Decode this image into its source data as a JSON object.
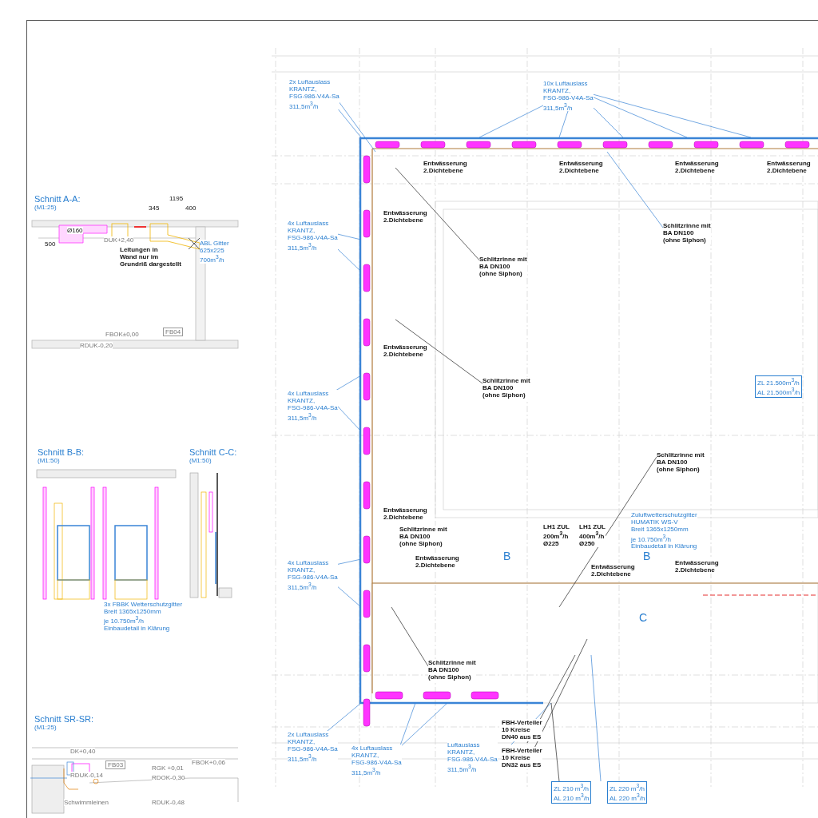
{
  "sections": [
    {
      "title": "Schnitt A-A:",
      "scale": "(M1:25)",
      "labels": [
        {
          "kind": "dimension",
          "lines": [
            "1195"
          ]
        },
        {
          "kind": "dimension",
          "lines": [
            "345"
          ]
        },
        {
          "kind": "dimension",
          "lines": [
            "400"
          ]
        },
        {
          "kind": "dimension",
          "lines": [
            "500"
          ]
        },
        {
          "kind": "dimension",
          "lines": [
            "Ø160"
          ]
        },
        {
          "kind": "level",
          "lines": [
            "DUK+2,40"
          ]
        },
        {
          "kind": "level",
          "lines": [
            "FBOK±0,00"
          ]
        },
        {
          "kind": "room",
          "lines": [
            "FB04"
          ]
        },
        {
          "kind": "level",
          "lines": [
            "RDUK-0,20"
          ]
        },
        {
          "kind": "note",
          "lines": [
            "Leitungen in",
            "Wand nur im",
            "Grundriß dargestellt"
          ]
        },
        {
          "kind": "duct",
          "lines": [
            "ABL Gitter",
            "625x225",
            "700m$^{3}$/h"
          ]
        }
      ]
    },
    {
      "title": "Schnitt B-B:",
      "scale": "(M1:50)",
      "labels": [
        {
          "kind": "duct",
          "lines": [
            "3x FBBK Wetterschutzgitter",
            "Breit 1365x1250mm",
            "je 10.750m$^{3}$/h",
            "Einbaudetail in Klärung"
          ]
        }
      ]
    },
    {
      "title": "Schnitt C-C:",
      "scale": "(M1:50)"
    },
    {
      "title": "Schnitt SR-SR:",
      "scale": "(M1:25)",
      "labels": [
        {
          "kind": "level",
          "lines": [
            "DK+0,40"
          ]
        },
        {
          "kind": "room",
          "lines": [
            "FB03"
          ]
        },
        {
          "kind": "level",
          "lines": [
            "RDUK-0,14"
          ]
        },
        {
          "kind": "level",
          "lines": [
            "RGK +0,01"
          ]
        },
        {
          "kind": "level",
          "lines": [
            "RDOK-0,30"
          ]
        },
        {
          "kind": "level",
          "lines": [
            "FBOK+0,06"
          ]
        },
        {
          "kind": "level",
          "lines": [
            "Schwimmleinen"
          ]
        },
        {
          "kind": "level",
          "lines": [
            "RDUK-0,48"
          ]
        }
      ]
    }
  ],
  "plan_notes": [
    {
      "kind": "duct",
      "lines": [
        "2x Luftauslass",
        "KRANTZ,",
        "FSG-986-V4A-Sa",
        "311,5m$^{3}$/h"
      ]
    },
    {
      "kind": "duct",
      "lines": [
        "10x Luftauslass",
        "KRANTZ,",
        "FSG-986-V4A-Sa",
        "311,5m$^{3}$/h"
      ]
    },
    {
      "kind": "duct",
      "lines": [
        "4x Luftauslass",
        "KRANTZ,",
        "FSG-986-V4A-Sa",
        "311,5m$^{3}$/h"
      ]
    },
    {
      "kind": "duct",
      "lines": [
        "4x Luftauslass",
        "KRANTZ,",
        "FSG-986-V4A-Sa",
        "311,5m$^{3}$/h"
      ]
    },
    {
      "kind": "duct",
      "lines": [
        "4x Luftauslass",
        "KRANTZ,",
        "FSG-986-V4A-Sa",
        "311,5m$^{3}$/h"
      ]
    },
    {
      "kind": "duct",
      "lines": [
        "2x Luftauslass",
        "KRANTZ,",
        "FSG-986-V4A-Sa",
        "311,5m$^{3}$/h"
      ]
    },
    {
      "kind": "duct",
      "lines": [
        "4x Luftauslass",
        "KRANTZ,",
        "FSG-986-V4A-Sa",
        "311,5m$^{3}$/h"
      ]
    },
    {
      "kind": "duct",
      "lines": [
        "Luftauslass",
        "KRANTZ,",
        "FSG-986-V4A-Sa",
        "311,5m$^{3}$/h"
      ]
    },
    {
      "kind": "note",
      "lines": [
        "Entwässerung",
        "2.Dichtebene"
      ]
    },
    {
      "kind": "note",
      "lines": [
        "Entwässerung",
        "2.Dichtebene"
      ]
    },
    {
      "kind": "note",
      "lines": [
        "Entwässerung",
        "2.Dichtebene"
      ]
    },
    {
      "kind": "note",
      "lines": [
        "Entwässerung",
        "2.Dichtebene"
      ]
    },
    {
      "kind": "note",
      "lines": [
        "Entwässerung",
        "2.Dichtebene"
      ]
    },
    {
      "kind": "note",
      "lines": [
        "Entwässerung",
        "2.Dichtebene"
      ]
    },
    {
      "kind": "note",
      "lines": [
        "Entwässerung",
        "2.Dichtebene"
      ]
    },
    {
      "kind": "note",
      "lines": [
        "Entwässerung",
        "2.Dichtebene"
      ]
    },
    {
      "kind": "note",
      "lines": [
        "Entwässerung",
        "2.Dichtebene"
      ]
    },
    {
      "kind": "note",
      "lines": [
        "Entwässerung",
        "2.Dichtebene"
      ]
    },
    {
      "kind": "note",
      "lines": [
        "Schlitzrinne mit",
        "BA DN100",
        "(ohne Siphon)"
      ]
    },
    {
      "kind": "note",
      "lines": [
        "Schlitzrinne mit",
        "BA DN100",
        "(ohne Siphon)"
      ]
    },
    {
      "kind": "note",
      "lines": [
        "Schlitzrinne mit",
        "BA DN100",
        "(ohne Siphon)"
      ]
    },
    {
      "kind": "note",
      "lines": [
        "Schlitzrinne mit",
        "BA DN100",
        "(ohne Siphon)"
      ]
    },
    {
      "kind": "note",
      "lines": [
        "Schlitzrinne mit",
        "BA DN100",
        "(ohne Siphon)"
      ]
    },
    {
      "kind": "note",
      "lines": [
        "Schlitzrinne mit",
        "BA DN100",
        "(ohne Siphon)"
      ]
    },
    {
      "kind": "note",
      "lines": [
        "FBH-Verteiler",
        "10 Kreise",
        "DN40 aus ES"
      ]
    },
    {
      "kind": "note",
      "lines": [
        "FBH-Verteiler",
        "10 Kreise",
        "DN32 aus ES"
      ]
    },
    {
      "kind": "flow",
      "lines": [
        "ZL 21.500m$^{3}$/h",
        "AL 21.500m$^{3}$/h"
      ]
    },
    {
      "kind": "flow",
      "lines": [
        "ZL 210   m$^{3}$/h",
        "AL 210   m$^{3}$/h"
      ]
    },
    {
      "kind": "flow",
      "lines": [
        "ZL 220   m$^{3}$/h",
        "AL 220   m$^{3}$/h"
      ]
    },
    {
      "kind": "note",
      "lines": [
        "LH1 ZUL",
        "200m$^{3}$/h",
        "Ø225"
      ]
    },
    {
      "kind": "note",
      "lines": [
        "LH1 ZUL",
        "400m$^{3}$/h",
        "Ø250"
      ]
    },
    {
      "kind": "duct",
      "lines": [
        "Zuluftwetterschutzgitter",
        "HUMATIK WS-V",
        "Breit 1365x1250mm",
        "je 10.750m$^{3}$/h",
        "Einbaudetail in Klärung"
      ]
    },
    {
      "kind": "marker",
      "lines": [
        "B"
      ]
    },
    {
      "kind": "marker",
      "lines": [
        "B"
      ]
    },
    {
      "kind": "marker",
      "lines": [
        "C"
      ]
    }
  ]
}
